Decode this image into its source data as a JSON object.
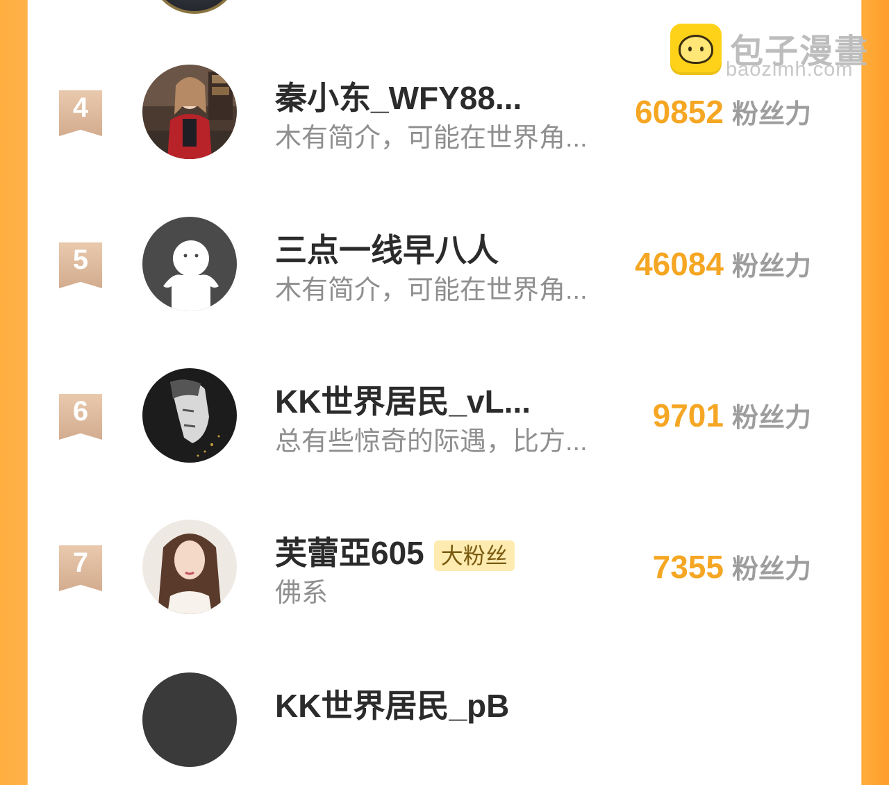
{
  "watermark": {
    "cn": "包子漫畫",
    "en": "baozimh.com"
  },
  "rows": [
    {
      "rank": "4",
      "name": "秦小东_WFY88...",
      "bio": "木有简介，可能在世界角...",
      "fans": "60852",
      "fans_label": "粉丝力",
      "tag": ""
    },
    {
      "rank": "5",
      "name": "三点一线早八人",
      "bio": "木有简介，可能在世界角...",
      "fans": "46084",
      "fans_label": "粉丝力",
      "tag": ""
    },
    {
      "rank": "6",
      "name": "KK世界居民_vL...",
      "bio": "总有些惊奇的际遇，比方...",
      "fans": "9701",
      "fans_label": "粉丝力",
      "tag": ""
    },
    {
      "rank": "7",
      "name": "芙蕾亞605",
      "bio": "佛系",
      "fans": "7355",
      "fans_label": "粉丝力",
      "tag": "大粉丝"
    },
    {
      "rank": "",
      "name": "KK世界居民_pB",
      "bio": "",
      "fans": "",
      "fans_label": "",
      "tag": ""
    }
  ],
  "colors": {
    "accent": "#f5a623",
    "rank_badge": "#d9b496",
    "tag_bg": "#fdebb0"
  }
}
